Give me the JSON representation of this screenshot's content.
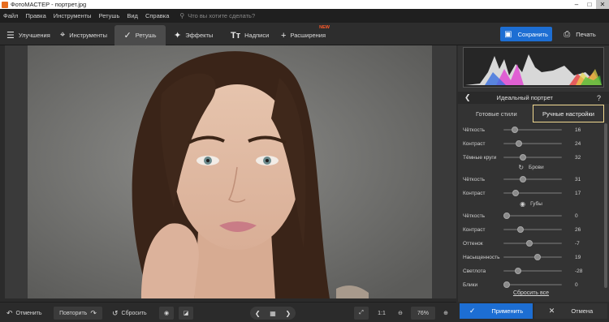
{
  "window": {
    "title": "ФотоМАСТЕР - портрет.jpg",
    "minimize": "–",
    "maximize": "□",
    "close": "✕"
  },
  "menu": {
    "items": [
      "Файл",
      "Правка",
      "Инструменты",
      "Ретушь",
      "Вид",
      "Справка"
    ],
    "search_placeholder": "Что вы хотите сделать?"
  },
  "toolbar": {
    "tabs": [
      {
        "label": "Улучшения",
        "icon": "sliders-icon"
      },
      {
        "label": "Инструменты",
        "icon": "crop-icon"
      },
      {
        "label": "Ретушь",
        "icon": "brush-icon",
        "active": true
      },
      {
        "label": "Эффекты",
        "icon": "magic-wand-icon"
      },
      {
        "label": "Надписи",
        "icon": "text-icon"
      },
      {
        "label": "Расширения",
        "icon": "plus-icon",
        "badge": "NEW"
      }
    ],
    "save_label": "Сохранить",
    "print_label": "Печать"
  },
  "panel": {
    "title": "Идеальный портрет",
    "help": "?",
    "tab_presets": "Готовые стили",
    "tab_manual": "Ручные настройки",
    "rows_a": [
      {
        "label": "Чёткость",
        "value": "16",
        "level": 0.16
      },
      {
        "label": "Контраст",
        "value": "24",
        "level": 0.24
      },
      {
        "label": "Тёмные круги",
        "value": "32",
        "level": 0.32
      }
    ],
    "group_brows": "Брови",
    "rows_b": [
      {
        "label": "Чёткость",
        "value": "31",
        "level": 0.31
      },
      {
        "label": "Контраст",
        "value": "17",
        "level": 0.17
      }
    ],
    "group_lips": "Губы",
    "rows_c": [
      {
        "label": "Чёткость",
        "value": "0",
        "level": 0.0
      },
      {
        "label": "Контраст",
        "value": "26",
        "level": 0.26
      },
      {
        "label": "Оттенок",
        "value": "-7",
        "level": 0.43
      },
      {
        "label": "Насыщенность",
        "value": "19",
        "level": 0.59
      },
      {
        "label": "Светлота",
        "value": "-28",
        "level": 0.22
      },
      {
        "label": "Блики",
        "value": "0",
        "level": 0.0
      }
    ],
    "reset_all": "Сбросить все"
  },
  "bottom": {
    "undo": "Отменить",
    "redo": "Повторить",
    "reset": "Сбросить",
    "ratio": "1:1",
    "zoom": "76%",
    "apply": "Применить",
    "cancel": "Отмена"
  },
  "colors": {
    "accent": "#1d6ed3",
    "highlight": "#f1d990",
    "badge": "#ff5a2a"
  }
}
